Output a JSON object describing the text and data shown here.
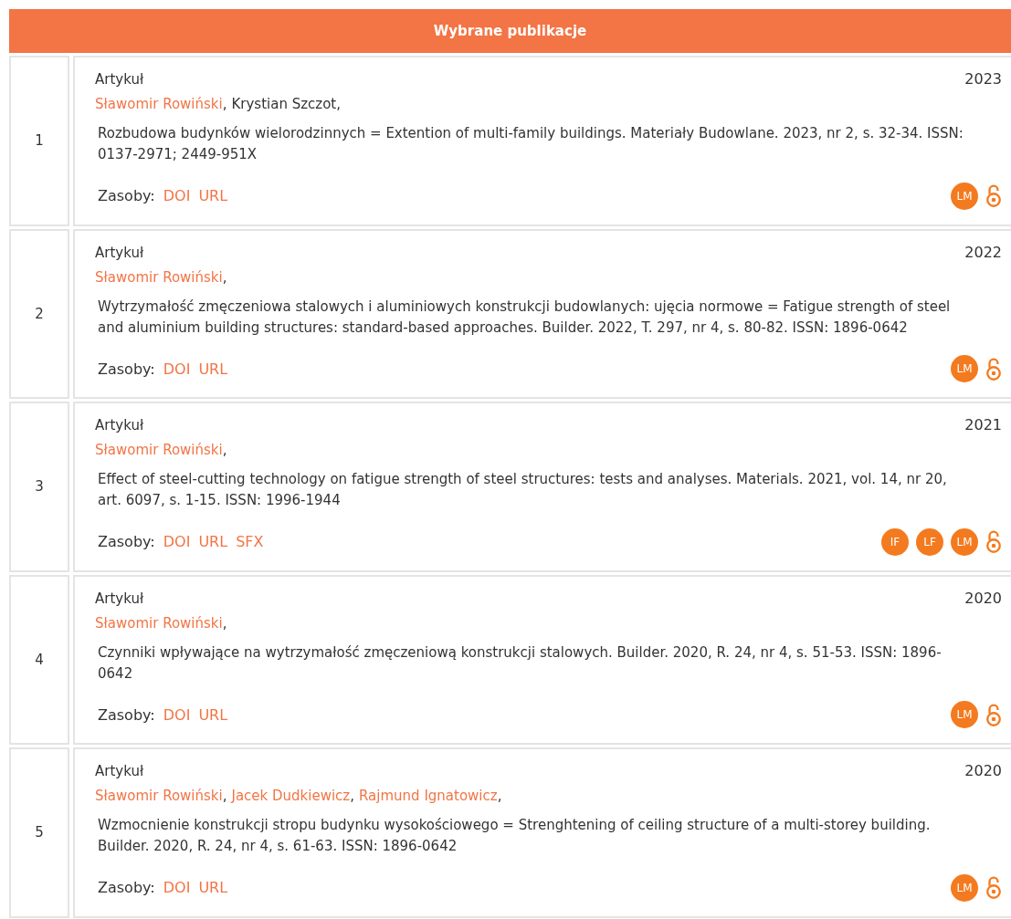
{
  "header": {
    "title": "Wybrane publikacje"
  },
  "publications": [
    {
      "number": "1",
      "type": "Artykuł",
      "year": "2023",
      "authors": [
        {
          "name": "Sławomir Rowiński",
          "linked": true
        },
        {
          "name": "Krystian Szczot",
          "linked": false
        }
      ],
      "separator": ",",
      "citation": "Rozbudowa budynków wielorodzinnych = Extention of multi-family buildings. Materiały Budowlane. 2023, nr 2, s. 32-34. ISSN: 0137-2971; 2449-951X",
      "resources_label": "Zasoby:",
      "resources": [
        "DOI",
        "URL"
      ],
      "badges": [
        {
          "kind": "circle",
          "label": "LM"
        },
        {
          "kind": "open_access"
        }
      ]
    },
    {
      "number": "2",
      "type": "Artykuł",
      "year": "2022",
      "authors": [
        {
          "name": "Sławomir Rowiński",
          "linked": true
        }
      ],
      "separator": ",",
      "citation": "Wytrzymałość zmęczeniowa stalowych i aluminiowych konstrukcji budowlanych: ujęcia normowe = Fatigue strength of steel and aluminium building structures: standard-based approaches. Builder. 2022, T. 297, nr 4, s. 80-82. ISSN: 1896-0642",
      "resources_label": "Zasoby:",
      "resources": [
        "DOI",
        "URL"
      ],
      "badges": [
        {
          "kind": "circle",
          "label": "LM"
        },
        {
          "kind": "open_access"
        }
      ]
    },
    {
      "number": "3",
      "type": "Artykuł",
      "year": "2021",
      "authors": [
        {
          "name": "Sławomir Rowiński",
          "linked": true
        }
      ],
      "separator": ",",
      "citation": "Effect of steel-cutting technology on fatigue strength of steel structures: tests and analyses. Materials. 2021, vol. 14, nr 20, art. 6097, s. 1-15. ISSN: 1996-1944",
      "resources_label": "Zasoby:",
      "resources": [
        "DOI",
        "URL",
        "SFX"
      ],
      "badges": [
        {
          "kind": "circle",
          "label": "IF"
        },
        {
          "kind": "circle",
          "label": "LF"
        },
        {
          "kind": "circle",
          "label": "LM"
        },
        {
          "kind": "open_access"
        }
      ]
    },
    {
      "number": "4",
      "type": "Artykuł",
      "year": "2020",
      "authors": [
        {
          "name": "Sławomir Rowiński",
          "linked": true
        }
      ],
      "separator": ",",
      "citation": "Czynniki wpływające na wytrzymałość zmęczeniową konstrukcji stalowych. Builder. 2020, R. 24, nr 4, s. 51-53. ISSN: 1896-0642",
      "resources_label": "Zasoby:",
      "resources": [
        "DOI",
        "URL"
      ],
      "badges": [
        {
          "kind": "circle",
          "label": "LM"
        },
        {
          "kind": "open_access"
        }
      ]
    },
    {
      "number": "5",
      "type": "Artykuł",
      "year": "2020",
      "authors": [
        {
          "name": "Sławomir Rowiński",
          "linked": true
        },
        {
          "name": "Jacek Dudkiewicz",
          "linked": true
        },
        {
          "name": "Rajmund Ignatowicz",
          "linked": true
        }
      ],
      "separator": ",",
      "citation": "Wzmocnienie konstrukcji stropu budynku wysokościowego = Strenghtening of ceiling structure of a multi-storey building. Builder. 2020, R. 24, nr 4, s. 61-63. ISSN: 1896-0642",
      "resources_label": "Zasoby:",
      "resources": [
        "DOI",
        "URL"
      ],
      "badges": [
        {
          "kind": "circle",
          "label": "LM"
        },
        {
          "kind": "open_access"
        }
      ]
    }
  ]
}
